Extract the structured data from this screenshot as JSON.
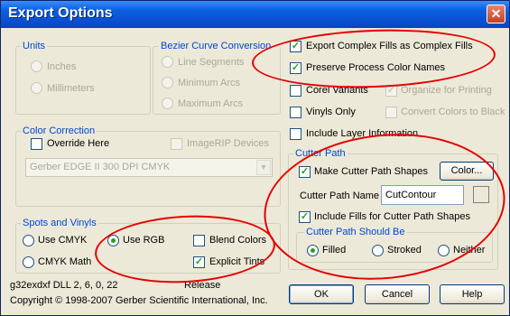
{
  "window": {
    "title": "Export Options",
    "close_glyph": "✕"
  },
  "units": {
    "legend": "Units",
    "inches": "Inches",
    "millimeters": "Millimeters"
  },
  "bezier": {
    "legend": "Bezier Curve Conversion",
    "line_segments": "Line Segments",
    "minimum_arcs": "Minimum Arcs",
    "maximum_arcs": "Maximum Arcs"
  },
  "options": {
    "export_complex_fills": "Export Complex Fills as Complex Fills",
    "preserve_process_color_names": "Preserve Process Color Names",
    "corel_variants": "Corel Variants",
    "organize_for_printing": "Organize for Printing",
    "vinyls_only": "Vinyls Only",
    "convert_colors_to_black": "Convert Colors to Black",
    "include_layer_information": "Include Layer Information"
  },
  "color_correction": {
    "legend": "Color Correction",
    "override_here": "Override Here",
    "imagerip_devices": "ImageRIP Devices",
    "device_value": "Gerber EDGE II 300 DPI CMYK"
  },
  "cutter_path": {
    "legend": "Cutter Path",
    "make_shapes": "Make Cutter Path Shapes",
    "color_button": "Color...",
    "name_label": "Cutter Path Name",
    "name_value": "CutContour",
    "include_fills": "Include Fills for Cutter Path Shapes",
    "should_be_legend": "Cutter Path Should Be",
    "filled": "Filled",
    "stroked": "Stroked",
    "neither": "Neither"
  },
  "spots": {
    "legend": "Spots and Vinyls",
    "use_cmyk": "Use CMYK",
    "use_rgb": "Use RGB",
    "blend_colors": "Blend Colors",
    "cmyk_math": "CMYK Math",
    "explicit_tints": "Explicit Tints"
  },
  "footer": {
    "dll_info": "g32exdxf DLL 2, 6, 0, 22",
    "release": "Release",
    "copyright": "Copyright © 1998-2007 Gerber Scientific International, Inc."
  },
  "buttons": {
    "ok": "OK",
    "cancel": "Cancel",
    "help": "Help"
  },
  "colors": {
    "title_bar": "#0a52d2",
    "group_legend": "#0046d5",
    "check_mark": "#21a121",
    "annotation": "#e60000",
    "dialog_bg": "#ece9d8"
  }
}
